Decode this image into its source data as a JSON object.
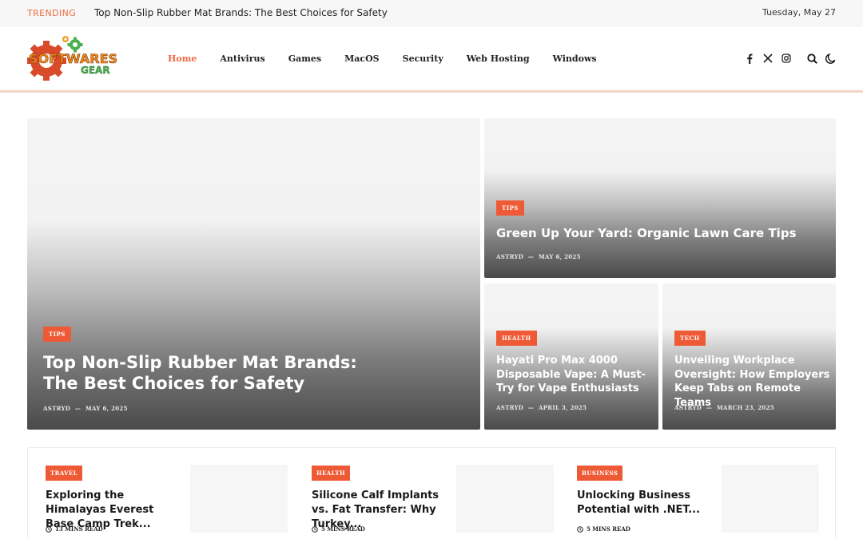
{
  "trending": {
    "label": "TRENDING",
    "headline": "Top Non-Slip Rubber Mat Brands: The Best Choices for Safety",
    "date": "Tuesday, May 27"
  },
  "logo": {
    "line1": "SOFTWARES",
    "line2": "GEAR"
  },
  "nav": {
    "items": [
      {
        "label": "Home",
        "active": true
      },
      {
        "label": "Antivirus"
      },
      {
        "label": "Games"
      },
      {
        "label": "MacOS"
      },
      {
        "label": "Security"
      },
      {
        "label": "Web Hosting"
      },
      {
        "label": "Windows"
      }
    ]
  },
  "header_icons": [
    "facebook-icon",
    "x-twitter-icon",
    "instagram-icon",
    "search-icon",
    "moon-icon"
  ],
  "colors": {
    "accent": "#ee6a44",
    "badge": "#ee5a35"
  },
  "hero": {
    "main": {
      "category": "TIPS",
      "title": "Top Non-Slip Rubber Mat Brands: The Best Choices for Safety",
      "author": "ASTRYD",
      "date": "MAY 6, 2025"
    },
    "top_right": {
      "category": "TIPS",
      "title": "Green Up Your Yard: Organic Lawn Care Tips",
      "author": "ASTRYD",
      "date": "MAY 6, 2025"
    },
    "bottom_left": {
      "category": "HEALTH",
      "title": "Hayati Pro Max 4000 Disposable Vape: A Must-Try for Vape Enthusiasts",
      "author": "ASTRYD",
      "date": "APRIL 3, 2025"
    },
    "bottom_right": {
      "category": "TECH",
      "title": "Unveiling Workplace Oversight: How Employers Keep Tabs on Remote Teams",
      "author": "ASTRYD",
      "date": "MARCH 23, 2025"
    }
  },
  "posts": [
    {
      "category": "TRAVEL",
      "title": "Exploring the Himalayas Everest Base Camp Trek...",
      "read": "13 MINS READ"
    },
    {
      "category": "HEALTH",
      "title": "Silicone Calf Implants vs. Fat Transfer: Why Turkey...",
      "read": "5 MINS READ"
    },
    {
      "category": "BUSINESS",
      "title": "Unlocking Business Potential with .NET...",
      "read": "5 MINS READ"
    }
  ],
  "separator": "—"
}
